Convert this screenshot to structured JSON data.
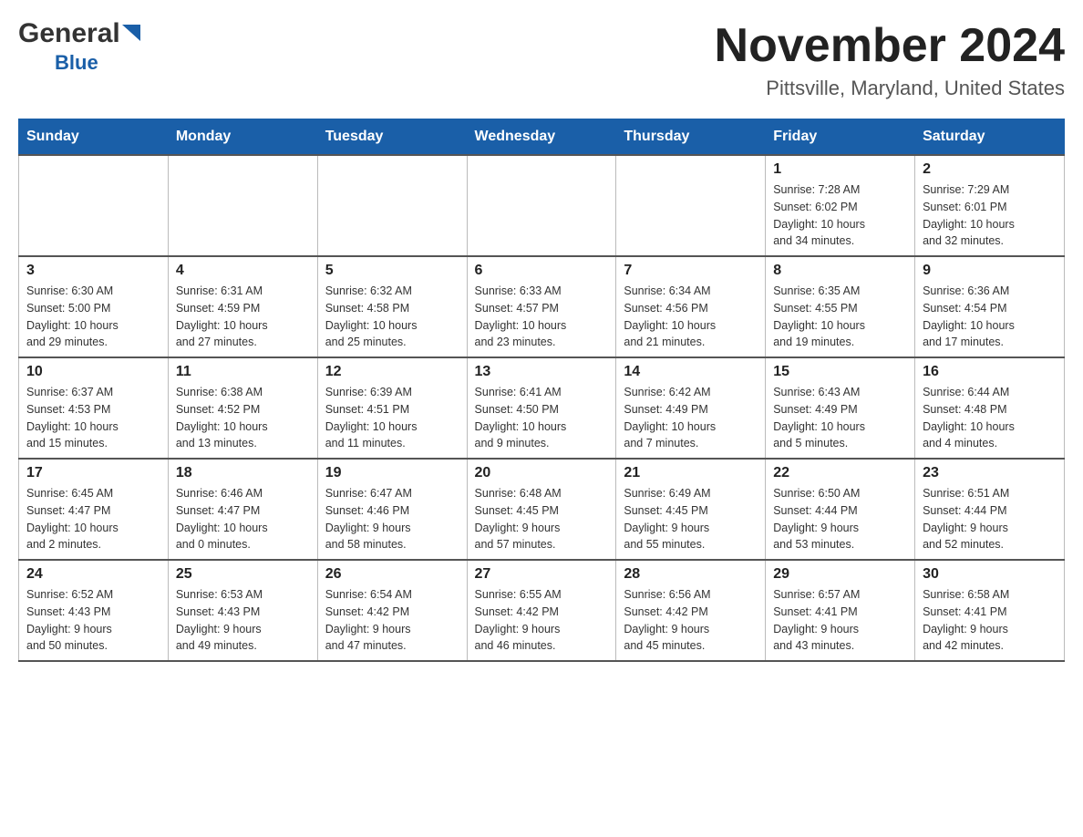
{
  "header": {
    "logo_general": "General",
    "logo_blue": "Blue",
    "title": "November 2024",
    "subtitle": "Pittsville, Maryland, United States"
  },
  "calendar": {
    "days_of_week": [
      "Sunday",
      "Monday",
      "Tuesday",
      "Wednesday",
      "Thursday",
      "Friday",
      "Saturday"
    ],
    "weeks": [
      [
        {
          "day": "",
          "info": ""
        },
        {
          "day": "",
          "info": ""
        },
        {
          "day": "",
          "info": ""
        },
        {
          "day": "",
          "info": ""
        },
        {
          "day": "",
          "info": ""
        },
        {
          "day": "1",
          "info": "Sunrise: 7:28 AM\nSunset: 6:02 PM\nDaylight: 10 hours\nand 34 minutes."
        },
        {
          "day": "2",
          "info": "Sunrise: 7:29 AM\nSunset: 6:01 PM\nDaylight: 10 hours\nand 32 minutes."
        }
      ],
      [
        {
          "day": "3",
          "info": "Sunrise: 6:30 AM\nSunset: 5:00 PM\nDaylight: 10 hours\nand 29 minutes."
        },
        {
          "day": "4",
          "info": "Sunrise: 6:31 AM\nSunset: 4:59 PM\nDaylight: 10 hours\nand 27 minutes."
        },
        {
          "day": "5",
          "info": "Sunrise: 6:32 AM\nSunset: 4:58 PM\nDaylight: 10 hours\nand 25 minutes."
        },
        {
          "day": "6",
          "info": "Sunrise: 6:33 AM\nSunset: 4:57 PM\nDaylight: 10 hours\nand 23 minutes."
        },
        {
          "day": "7",
          "info": "Sunrise: 6:34 AM\nSunset: 4:56 PM\nDaylight: 10 hours\nand 21 minutes."
        },
        {
          "day": "8",
          "info": "Sunrise: 6:35 AM\nSunset: 4:55 PM\nDaylight: 10 hours\nand 19 minutes."
        },
        {
          "day": "9",
          "info": "Sunrise: 6:36 AM\nSunset: 4:54 PM\nDaylight: 10 hours\nand 17 minutes."
        }
      ],
      [
        {
          "day": "10",
          "info": "Sunrise: 6:37 AM\nSunset: 4:53 PM\nDaylight: 10 hours\nand 15 minutes."
        },
        {
          "day": "11",
          "info": "Sunrise: 6:38 AM\nSunset: 4:52 PM\nDaylight: 10 hours\nand 13 minutes."
        },
        {
          "day": "12",
          "info": "Sunrise: 6:39 AM\nSunset: 4:51 PM\nDaylight: 10 hours\nand 11 minutes."
        },
        {
          "day": "13",
          "info": "Sunrise: 6:41 AM\nSunset: 4:50 PM\nDaylight: 10 hours\nand 9 minutes."
        },
        {
          "day": "14",
          "info": "Sunrise: 6:42 AM\nSunset: 4:49 PM\nDaylight: 10 hours\nand 7 minutes."
        },
        {
          "day": "15",
          "info": "Sunrise: 6:43 AM\nSunset: 4:49 PM\nDaylight: 10 hours\nand 5 minutes."
        },
        {
          "day": "16",
          "info": "Sunrise: 6:44 AM\nSunset: 4:48 PM\nDaylight: 10 hours\nand 4 minutes."
        }
      ],
      [
        {
          "day": "17",
          "info": "Sunrise: 6:45 AM\nSunset: 4:47 PM\nDaylight: 10 hours\nand 2 minutes."
        },
        {
          "day": "18",
          "info": "Sunrise: 6:46 AM\nSunset: 4:47 PM\nDaylight: 10 hours\nand 0 minutes."
        },
        {
          "day": "19",
          "info": "Sunrise: 6:47 AM\nSunset: 4:46 PM\nDaylight: 9 hours\nand 58 minutes."
        },
        {
          "day": "20",
          "info": "Sunrise: 6:48 AM\nSunset: 4:45 PM\nDaylight: 9 hours\nand 57 minutes."
        },
        {
          "day": "21",
          "info": "Sunrise: 6:49 AM\nSunset: 4:45 PM\nDaylight: 9 hours\nand 55 minutes."
        },
        {
          "day": "22",
          "info": "Sunrise: 6:50 AM\nSunset: 4:44 PM\nDaylight: 9 hours\nand 53 minutes."
        },
        {
          "day": "23",
          "info": "Sunrise: 6:51 AM\nSunset: 4:44 PM\nDaylight: 9 hours\nand 52 minutes."
        }
      ],
      [
        {
          "day": "24",
          "info": "Sunrise: 6:52 AM\nSunset: 4:43 PM\nDaylight: 9 hours\nand 50 minutes."
        },
        {
          "day": "25",
          "info": "Sunrise: 6:53 AM\nSunset: 4:43 PM\nDaylight: 9 hours\nand 49 minutes."
        },
        {
          "day": "26",
          "info": "Sunrise: 6:54 AM\nSunset: 4:42 PM\nDaylight: 9 hours\nand 47 minutes."
        },
        {
          "day": "27",
          "info": "Sunrise: 6:55 AM\nSunset: 4:42 PM\nDaylight: 9 hours\nand 46 minutes."
        },
        {
          "day": "28",
          "info": "Sunrise: 6:56 AM\nSunset: 4:42 PM\nDaylight: 9 hours\nand 45 minutes."
        },
        {
          "day": "29",
          "info": "Sunrise: 6:57 AM\nSunset: 4:41 PM\nDaylight: 9 hours\nand 43 minutes."
        },
        {
          "day": "30",
          "info": "Sunrise: 6:58 AM\nSunset: 4:41 PM\nDaylight: 9 hours\nand 42 minutes."
        }
      ]
    ]
  }
}
